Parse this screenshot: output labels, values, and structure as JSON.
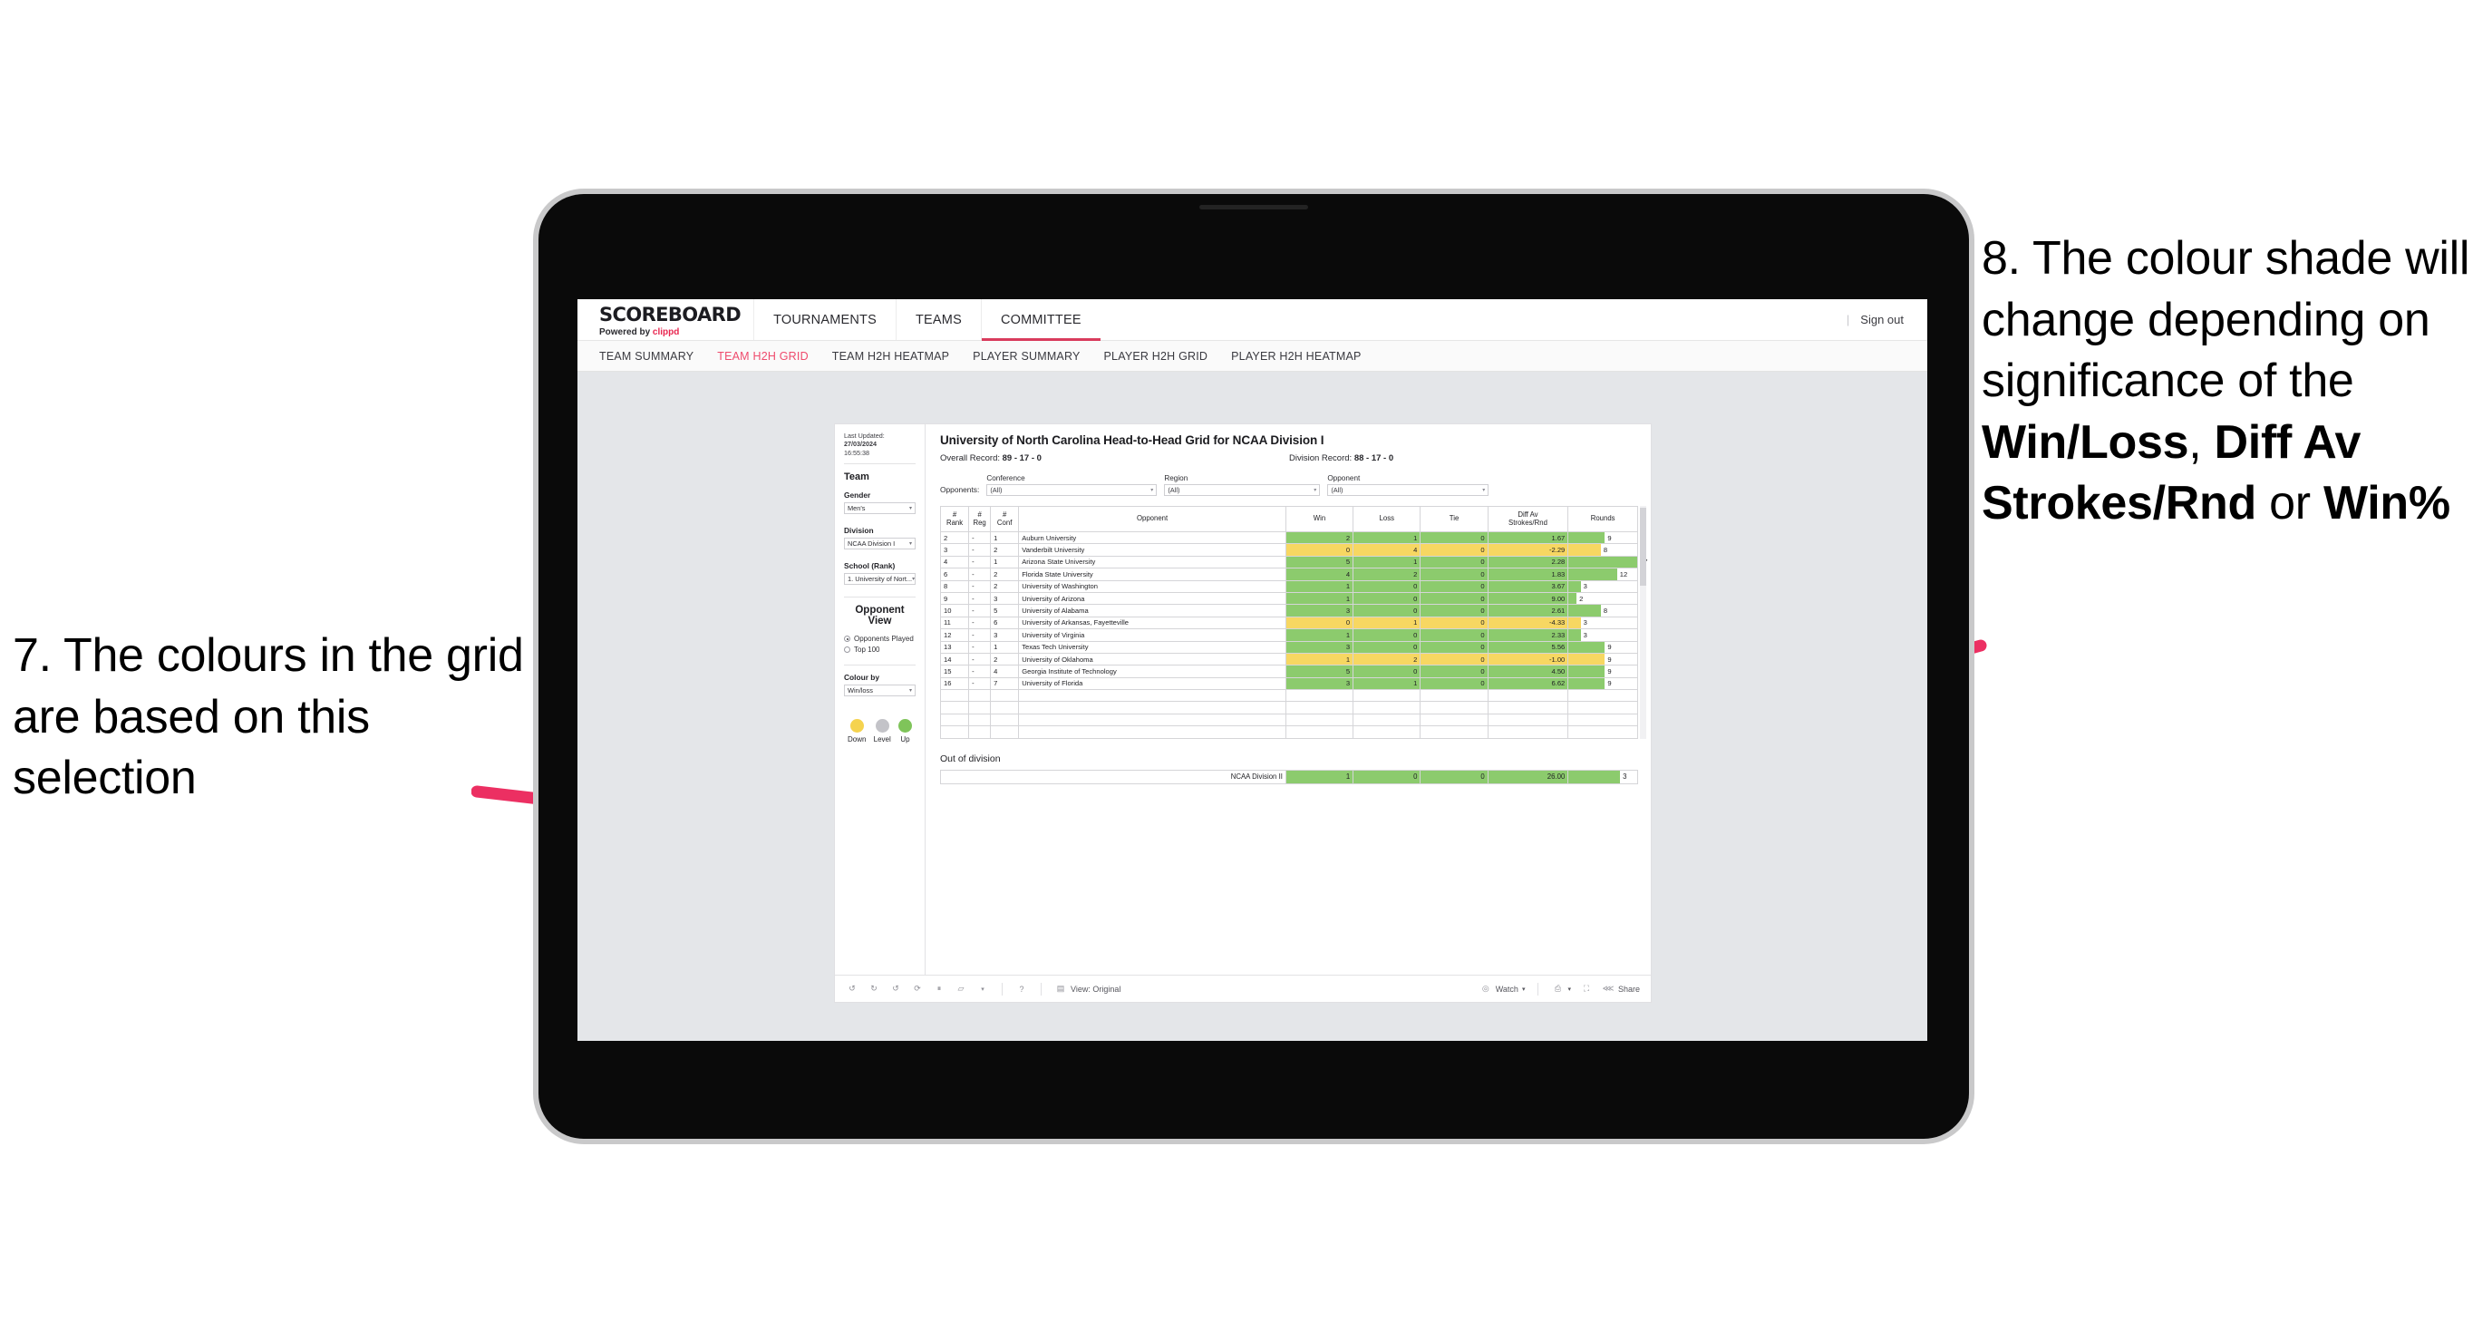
{
  "annotations": {
    "left": {
      "number": "7.",
      "text": "7. The colours in the grid are based on this selection"
    },
    "right": {
      "line1": "8. The colour shade will change depending on significance of the ",
      "bold1": "Win/Loss",
      "sep1": ", ",
      "bold2": "Diff Av Strokes/Rnd",
      "sep2": " or ",
      "bold3": "Win%"
    },
    "arrow_color": "#ec2f62"
  },
  "app": {
    "brand": {
      "title": "SCOREBOARD",
      "powered_prefix": "Powered by ",
      "powered_brand": "clippd"
    },
    "topnav": [
      {
        "label": "TOURNAMENTS",
        "active": false
      },
      {
        "label": "TEAMS",
        "active": false
      },
      {
        "label": "COMMITTEE",
        "active": true
      }
    ],
    "signout": {
      "divider": "|",
      "label": "Sign out"
    },
    "subnav": [
      {
        "label": "TEAM SUMMARY",
        "active": false
      },
      {
        "label": "TEAM H2H GRID",
        "active": true
      },
      {
        "label": "TEAM H2H HEATMAP",
        "active": false
      },
      {
        "label": "PLAYER SUMMARY",
        "active": false
      },
      {
        "label": "PLAYER H2H GRID",
        "active": false
      },
      {
        "label": "PLAYER H2H HEATMAP",
        "active": false
      }
    ],
    "accent": "#ef4b6d"
  },
  "sidebar": {
    "last_updated_label": "Last Updated:",
    "last_updated_date": "27/03/2024",
    "last_updated_time": "16:55:38",
    "team_heading": "Team",
    "gender": {
      "label": "Gender",
      "value": "Men's"
    },
    "division": {
      "label": "Division",
      "value": "NCAA Division I"
    },
    "school": {
      "label": "School (Rank)",
      "value": "1. University of Nort..."
    },
    "opponent_view": {
      "heading": "Opponent View",
      "options": [
        {
          "label": "Opponents Played",
          "selected": true
        },
        {
          "label": "Top 100",
          "selected": false
        }
      ]
    },
    "colour_by": {
      "label": "Colour by",
      "value": "Win/loss"
    },
    "legend": [
      {
        "label": "Down",
        "color": "#f5d34f"
      },
      {
        "label": "Level",
        "color": "#c3c3c8"
      },
      {
        "label": "Up",
        "color": "#7fc45a"
      }
    ]
  },
  "main": {
    "title": "University of North Carolina Head-to-Head Grid for NCAA Division I",
    "overall_record_label": "Overall Record:",
    "overall_record_value": "89 - 17 - 0",
    "division_record_label": "Division Record:",
    "division_record_value": "88 - 17 - 0",
    "opponents_label": "Opponents:",
    "filters": [
      {
        "caption": "Conference",
        "value": "(All)"
      },
      {
        "caption": "Region",
        "value": "(All)"
      },
      {
        "caption": "Opponent",
        "value": "(All)"
      }
    ]
  },
  "chart_data": {
    "type": "table",
    "title": "University of North Carolina Head-to-Head Grid for NCAA Division I",
    "columns": [
      "# Rank",
      "# Reg",
      "# Conf",
      "Opponent",
      "Win",
      "Loss",
      "Tie",
      "Diff Av Strokes/Rnd",
      "Rounds"
    ],
    "column_header_lines": [
      [
        "#",
        "Rank"
      ],
      [
        "#",
        "Reg"
      ],
      [
        "#",
        "Conf"
      ],
      [
        "Opponent",
        ""
      ],
      [
        "Win",
        ""
      ],
      [
        "Loss",
        ""
      ],
      [
        "Tie",
        ""
      ],
      [
        "Diff Av",
        "Strokes/Rnd"
      ],
      [
        "Rounds",
        ""
      ]
    ],
    "colors": {
      "up": "#8ccb6d",
      "down": "#f7d762",
      "level": "#c3c3c8"
    },
    "rounds_max": 17,
    "rows": [
      {
        "rank": "2",
        "reg": "-",
        "conf": "1",
        "opponent": "Auburn University",
        "win": "2",
        "loss": "1",
        "tie": "0",
        "diff": "1.67",
        "rounds": "9",
        "state": "up"
      },
      {
        "rank": "3",
        "reg": "-",
        "conf": "2",
        "opponent": "Vanderbilt University",
        "win": "0",
        "loss": "4",
        "tie": "0",
        "diff": "-2.29",
        "rounds": "8",
        "state": "down"
      },
      {
        "rank": "4",
        "reg": "-",
        "conf": "1",
        "opponent": "Arizona State University",
        "win": "5",
        "loss": "1",
        "tie": "0",
        "diff": "2.28",
        "rounds": "17",
        "state": "up"
      },
      {
        "rank": "6",
        "reg": "-",
        "conf": "2",
        "opponent": "Florida State University",
        "win": "4",
        "loss": "2",
        "tie": "0",
        "diff": "1.83",
        "rounds": "12",
        "state": "up"
      },
      {
        "rank": "8",
        "reg": "-",
        "conf": "2",
        "opponent": "University of Washington",
        "win": "1",
        "loss": "0",
        "tie": "0",
        "diff": "3.67",
        "rounds": "3",
        "state": "up"
      },
      {
        "rank": "9",
        "reg": "-",
        "conf": "3",
        "opponent": "University of Arizona",
        "win": "1",
        "loss": "0",
        "tie": "0",
        "diff": "9.00",
        "rounds": "2",
        "state": "up"
      },
      {
        "rank": "10",
        "reg": "-",
        "conf": "5",
        "opponent": "University of Alabama",
        "win": "3",
        "loss": "0",
        "tie": "0",
        "diff": "2.61",
        "rounds": "8",
        "state": "up"
      },
      {
        "rank": "11",
        "reg": "-",
        "conf": "6",
        "opponent": "University of Arkansas, Fayetteville",
        "win": "0",
        "loss": "1",
        "tie": "0",
        "diff": "-4.33",
        "rounds": "3",
        "state": "down"
      },
      {
        "rank": "12",
        "reg": "-",
        "conf": "3",
        "opponent": "University of Virginia",
        "win": "1",
        "loss": "0",
        "tie": "0",
        "diff": "2.33",
        "rounds": "3",
        "state": "up"
      },
      {
        "rank": "13",
        "reg": "-",
        "conf": "1",
        "opponent": "Texas Tech University",
        "win": "3",
        "loss": "0",
        "tie": "0",
        "diff": "5.56",
        "rounds": "9",
        "state": "up"
      },
      {
        "rank": "14",
        "reg": "-",
        "conf": "2",
        "opponent": "University of Oklahoma",
        "win": "1",
        "loss": "2",
        "tie": "0",
        "diff": "-1.00",
        "rounds": "9",
        "state": "down"
      },
      {
        "rank": "15",
        "reg": "-",
        "conf": "4",
        "opponent": "Georgia Institute of Technology",
        "win": "5",
        "loss": "0",
        "tie": "0",
        "diff": "4.50",
        "rounds": "9",
        "state": "up"
      },
      {
        "rank": "16",
        "reg": "-",
        "conf": "7",
        "opponent": "University of Florida",
        "win": "3",
        "loss": "1",
        "tie": "0",
        "diff": "6.62",
        "rounds": "9",
        "state": "up"
      }
    ],
    "out_of_division": {
      "title": "Out of division",
      "row": {
        "name": "NCAA Division II",
        "win": "1",
        "loss": "0",
        "tie": "0",
        "diff": "26.00",
        "rounds": "3",
        "state": "up"
      }
    }
  },
  "toolbar": {
    "undo": "undo-icon",
    "redo": "redo-icon",
    "revert": "revert-icon",
    "refresh": "refresh-data-icon",
    "pause": "pause-updates-icon",
    "view_shape": "custom-view-icon",
    "help": "help-icon",
    "view_label": "View: Original",
    "watch_label": "Watch",
    "download_label": "download-icon",
    "fullscreen_label": "fullscreen-icon",
    "share_label": "Share"
  }
}
